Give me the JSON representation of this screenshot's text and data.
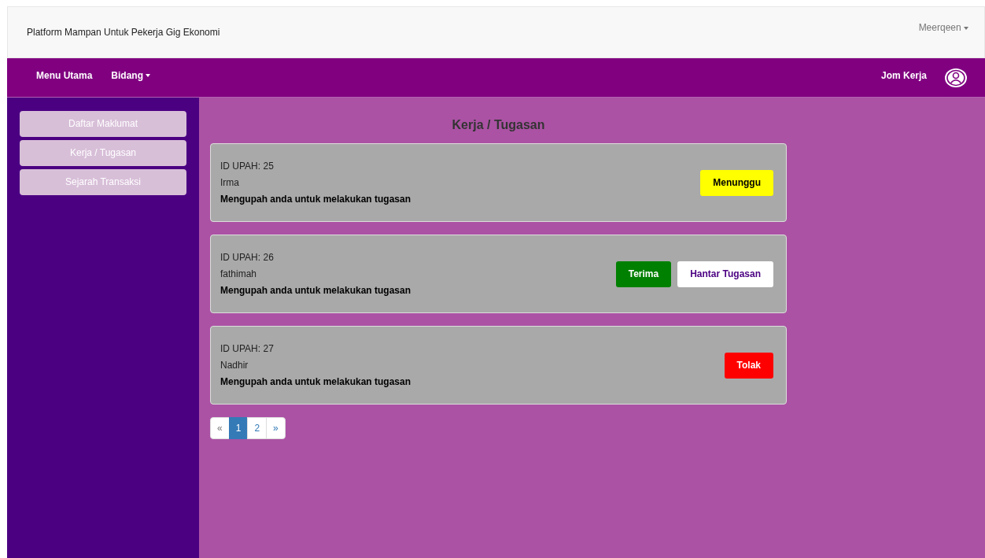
{
  "brand": "Platform Mampan Untuk Pekerja Gig Ekonomi",
  "user_menu": {
    "label": "Meerqeen"
  },
  "nav": {
    "items": [
      {
        "label": "Menu Utama",
        "dropdown": false
      },
      {
        "label": "Bidang",
        "dropdown": true
      }
    ],
    "right_label": "Jom Kerja"
  },
  "sidebar": {
    "items": [
      {
        "label": "Daftar Maklumat"
      },
      {
        "label": "Kerja / Tugasan"
      },
      {
        "label": "Sejarah Transaksi"
      }
    ]
  },
  "page_title": "Kerja / Tugasan",
  "jobs": [
    {
      "id_label": "ID UPAH: 25",
      "name": "Irma",
      "message": "Mengupah anda untuk melakukan tugasan",
      "actions": [
        {
          "label": "Menunggu",
          "kind": "pending"
        }
      ]
    },
    {
      "id_label": "ID UPAH: 26",
      "name": "fathimah",
      "message": "Mengupah anda untuk melakukan tugasan",
      "actions": [
        {
          "label": "Terima",
          "kind": "accept"
        },
        {
          "label": "Hantar Tugasan",
          "kind": "submit"
        }
      ]
    },
    {
      "id_label": "ID UPAH: 27",
      "name": "Nadhir",
      "message": "Mengupah anda untuk melakukan tugasan",
      "actions": [
        {
          "label": "Tolak",
          "kind": "reject"
        }
      ]
    }
  ],
  "pagination": [
    {
      "label": "«",
      "selected": false
    },
    {
      "label": "1",
      "selected": true
    },
    {
      "label": "2",
      "selected": false
    },
    {
      "label": "»",
      "selected": false
    }
  ]
}
